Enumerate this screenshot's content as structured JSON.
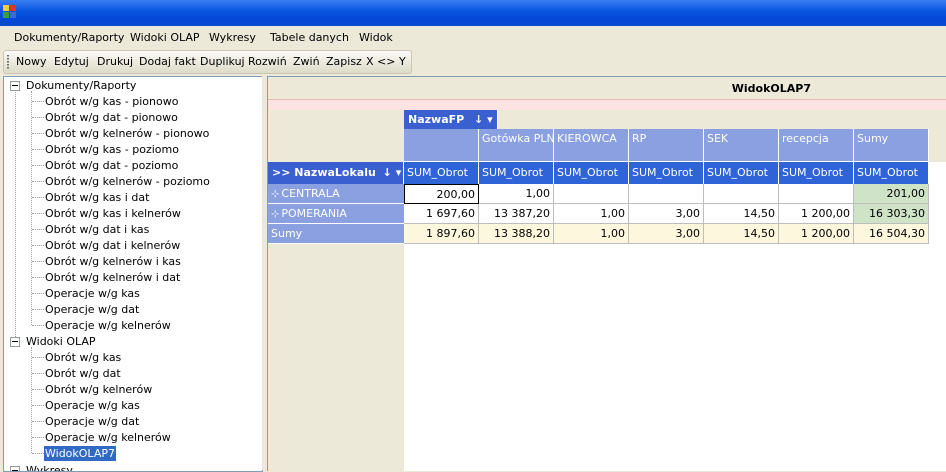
{
  "menu": {
    "items": [
      "Dokumenty/Raporty",
      "Widoki OLAP",
      "Wykresy",
      "Tabele danych",
      "Widok"
    ]
  },
  "toolbar": {
    "buttons": [
      "Nowy",
      "Edytuj",
      "Drukuj",
      "Dodaj fakt",
      "Duplikuj",
      "Rozwiń",
      "Zwiń",
      "Zapisz",
      "X <> Y"
    ]
  },
  "tree": {
    "group1": {
      "label": "Dokumenty/Raporty",
      "items": [
        "Obrót w/g kas - pionowo",
        "Obrót w/g dat - pionowo",
        "Obrót w/g kelnerów - pionowo",
        "Obrót w/g kas - poziomo",
        "Obrót w/g dat - poziomo",
        "Obrót w/g kelnerów - poziomo",
        "Obrót w/g kas i dat",
        "Obrót w/g kas i kelnerów",
        "Obrót w/g dat i kas",
        "Obrót w/g dat i kelnerów",
        "Obrót w/g kelnerów i kas",
        "Obrót w/g kelnerów i dat",
        "Operacje w/g kas",
        "Operacje w/g dat",
        "Operacje w/g kelnerów"
      ]
    },
    "group2": {
      "label": "Widoki OLAP",
      "items": [
        "Obrót w/g kas",
        "Obrót w/g dat",
        "Obrót w/g kelnerów",
        "Operacje w/g kas",
        "Operacje w/g dat",
        "Operacje w/g kelnerów",
        "WidokOLAP7"
      ],
      "selected_item": "WidokOLAP7"
    },
    "group3": {
      "label": "Wykresy"
    }
  },
  "olap": {
    "title": "WidokOLAP7",
    "column_field": "NazwaFP",
    "row_field": "NazwaLokalu",
    "column_headers": [
      "",
      "Gotówka PLN",
      "KIEROWCA",
      "RP",
      "SEK",
      "recepcja",
      "Sumy"
    ],
    "measure_label": "SUM_Obrot",
    "rows": [
      {
        "label": "CENTRALA",
        "values": [
          "200,00",
          "1,00",
          "",
          "",
          "",
          "",
          "201,00"
        ]
      },
      {
        "label": "POMERANIA",
        "values": [
          "1 697,60",
          "13 387,20",
          "1,00",
          "3,00",
          "14,50",
          "1 200,00",
          "16 303,30"
        ]
      },
      {
        "label": "Sumy",
        "values": [
          "1 897,60",
          "13 388,20",
          "1,00",
          "3,00",
          "14,50",
          "1 200,00",
          "16 504,30"
        ]
      }
    ]
  },
  "colors": {
    "title_bar": "#0a58e0",
    "header_blue": "#8aa0e0",
    "measure_blue": "#2f63d8",
    "selection": "#316ac5",
    "sum_column": "#cfe3c6",
    "sum_row": "#fdf7dd"
  }
}
